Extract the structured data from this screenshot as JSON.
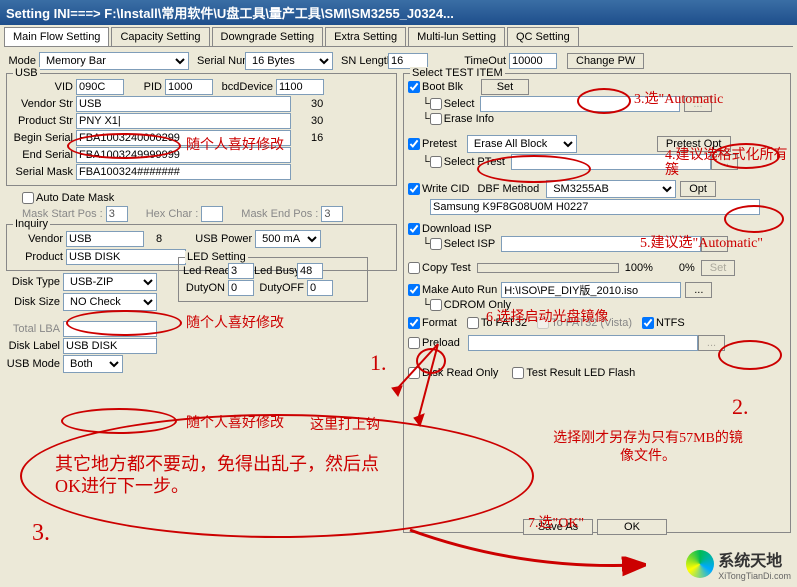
{
  "window": {
    "title": "Setting  INI===> F:\\Install\\常用软件\\U盘工具\\量产工具\\SMI\\SM3255_J0324..."
  },
  "tabs": [
    "Main Flow Setting",
    "Capacity Setting",
    "Downgrade Setting",
    "Extra Setting",
    "Multi-lun Setting",
    "QC Setting"
  ],
  "topbar": {
    "mode_lbl": "Mode",
    "mode": "Memory Bar",
    "serial_lbl": "Serial Number",
    "serial": "16 Bytes",
    "sn_len_lbl": "SN Length",
    "sn_len": "16",
    "timeout_lbl": "TimeOut",
    "timeout": "10000",
    "change_pw": "Change PW"
  },
  "usb": {
    "legend": "USB",
    "vid_lbl": "VID",
    "vid": "090C",
    "pid_lbl": "PID",
    "pid": "1000",
    "bcd_lbl": "bcdDevice",
    "bcd": "1100",
    "vendor_lbl": "Vendor Str",
    "vendor": "USB",
    "v30": "30",
    "product_lbl": "Product Str",
    "product": "PNY X1|",
    "p30": "30",
    "begin_lbl": "Begin Serial",
    "begin": "FBA1003240000299",
    "b16": "16",
    "end_lbl": "End Serial",
    "end": "FBA1003249999999",
    "mask_lbl": "Serial Mask",
    "mask": "FBA100324#######"
  },
  "date_mask": {
    "chk": "Auto Date Mask",
    "start_lbl": "Mask Start Pos :",
    "start": "3",
    "hex_lbl": "Hex Char :",
    "end_lbl": "Mask End Pos :",
    "end": "3"
  },
  "inquiry": {
    "legend": "Inquiry",
    "vendor_lbl": "Vendor",
    "vendor": "USB",
    "v8": "8",
    "power_lbl": "USB Power",
    "power": "500 mA",
    "product_lbl": "Product",
    "product": "USB DISK"
  },
  "disk": {
    "type_lbl": "Disk Type",
    "type": "USB-ZIP",
    "size_lbl": "Disk Size",
    "size": "NO Check",
    "total_lbl": "Total LBA",
    "total": "",
    "label_lbl": "Disk Label",
    "label": "USB DISK",
    "mode_lbl": "USB Mode",
    "mode": "Both"
  },
  "led": {
    "legend": "LED Setting",
    "ready_lbl": "Led Ready",
    "ready": "3",
    "busy_lbl": "Led Busy",
    "busy": "48",
    "on_lbl": "DutyON",
    "on": "0",
    "off_lbl": "DutyOFF",
    "off": "0"
  },
  "test": {
    "legend": "Select TEST ITEM",
    "boot_blk": "Boot Blk",
    "set_btn": "Set",
    "select": "Select",
    "erase_info": "Erase Info",
    "pretest": "Pretest",
    "erase_all": "Erase All Block",
    "pretest_opt": "Pretest Opt",
    "select_ptest": "Select PTest",
    "write_cid": "Write CID",
    "dbf_lbl": "DBF Method",
    "dbf": "SM3255AB",
    "opt": "Opt",
    "chip": "Samsung K9F8G08U0M H0227",
    "download_isp": "Download ISP",
    "select_isp": "Select ISP",
    "copy_test": "Copy Test",
    "pct": "100%",
    "pct0": "0%",
    "set2": "Set",
    "make_auto": "Make Auto Run",
    "iso": "H:\\ISO\\PE_DIY版_2010.iso",
    "browse": "...",
    "cdrom": "CDROM Only",
    "format": "Format",
    "fat32": "To FAT32",
    "fat32v": "To FAT32 (Vista)",
    "ntfs": "NTFS",
    "preload": "Preload",
    "preload_path": "",
    "browse2": "...",
    "read_only": "Disk Read Only",
    "led_flash": "Test Result LED Flash"
  },
  "buttons": {
    "save": "Save As",
    "ok": "OK"
  },
  "anno": {
    "a1": "1.",
    "a1b": "这里打上钩",
    "a2": "2.",
    "a2b": "选择刚才另存为只有57MB的镜像文件。",
    "a3": "3.",
    "a3b": "其它地方都不要动，免得出乱子，然后点OK进行下一步。",
    "a4": "4.建议选格式化所有簇",
    "a5": "5.建议选\"Automatic\"",
    "a6": "6.选择启动光盘镜像",
    "a7": "3.选\"Automatic",
    "a8": "7.选\"OK\"",
    "p1": "随个人喜好修改",
    "p2": "随个人喜好修改",
    "p3": "随个人喜好修改"
  },
  "logo": {
    "text": "系统天地",
    "url": "XiTongTianDi.com"
  }
}
